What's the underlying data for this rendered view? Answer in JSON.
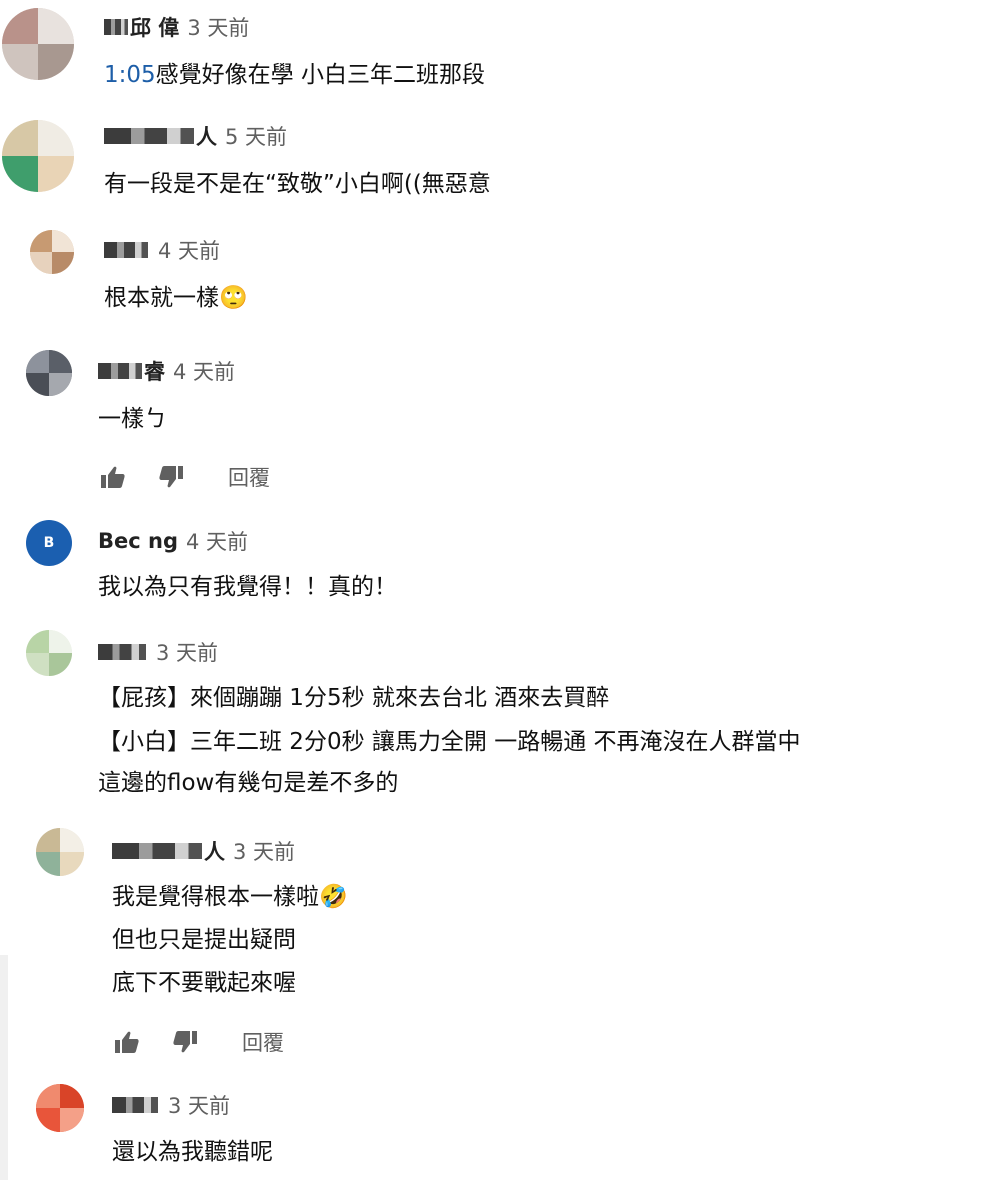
{
  "colors": {
    "link": "#1d5ea8",
    "author": "#222222",
    "time": "#606060",
    "text": "#111111"
  },
  "comments": [
    {
      "author_visible": "邱 偉",
      "time": "3 天前",
      "timestamp_link": "1:05",
      "lines": [
        "感覺好像在學 小白三年二班那段"
      ]
    },
    {
      "author_visible": "人",
      "time": "5 天前",
      "lines": [
        "有一段是不是在“致敬”小白啊((無惡意"
      ]
    },
    {
      "author_visible": "",
      "time": "4 天前",
      "lines": [
        "根本就一樣🙄"
      ]
    },
    {
      "author_visible": "睿",
      "time": "4 天前",
      "lines": [
        "一樣ㄅ"
      ],
      "reply_label": "回覆"
    },
    {
      "author_visible": "Bec ng",
      "avatar_letter": "B",
      "time": "4 天前",
      "lines": [
        "我以為只有我覺得！！真的！"
      ]
    },
    {
      "author_visible": "",
      "time": "3 天前",
      "lines": [
        "【屁孩】來個蹦蹦 1分5秒  就來去台北 酒來去買醉",
        "【小白】三年二班 2分0秒 讓馬力全開 一路暢通  不再淹沒在人群當中",
        "這邊的flow有幾句是差不多的"
      ]
    },
    {
      "author_visible": "人",
      "time": "3 天前",
      "lines": [
        "我是覺得根本一樣啦🤣",
        "但也只是提出疑問",
        "底下不要戰起來喔"
      ],
      "reply_label": "回覆"
    },
    {
      "author_visible": "",
      "time": "3 天前",
      "lines": [
        "還以為我聽錯呢"
      ]
    }
  ],
  "icons": {
    "like": "thumbs-up-icon",
    "dislike": "thumbs-down-icon"
  }
}
